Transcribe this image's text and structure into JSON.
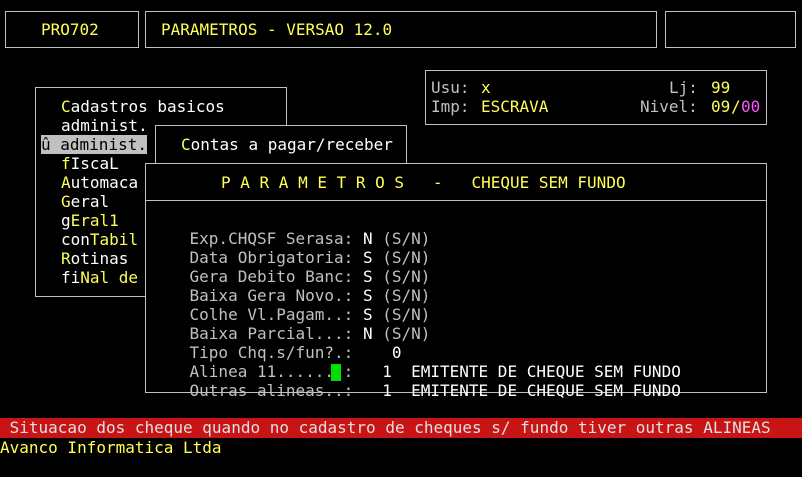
{
  "header": {
    "program_code": "PRO702",
    "title": "PARAMETROS - VERSAO 12.0"
  },
  "user_panel": {
    "usu_label": "Usu:",
    "usu_value": "x",
    "lj_label": "Lj:",
    "lj_value": "99",
    "imp_label": "Imp:",
    "imp_value": "ESCRAVA",
    "nivel_label": "Nivel:",
    "nivel_value_a": "09",
    "nivel_sep": "/",
    "nivel_value_b": "00"
  },
  "main_menu": {
    "items": [
      {
        "hot": "C",
        "rest": "adastros basicos"
      },
      {
        "hot": "",
        "rest": "administ."
      },
      {
        "hot": "û",
        "rest": " administ."
      },
      {
        "hot": "f",
        "rest": "IscaL"
      },
      {
        "hot": "A",
        "rest": "utomaca"
      },
      {
        "hot": "G",
        "rest": "eral"
      },
      {
        "hot": "g",
        "rest": "Eral1"
      },
      {
        "hot": "con",
        "rest": "Tabil"
      },
      {
        "hot": "R",
        "rest": "otinas"
      },
      {
        "hot": "fi",
        "rest": "Nal de"
      }
    ]
  },
  "submenu": {
    "hot": "C",
    "rest": "ontas a pagar/receber"
  },
  "dialog": {
    "title": "P A R A M E T R O S   -   CHEQUE SEM FUNDO",
    "fields": [
      {
        "label": "Exp.CHQSF Serasa:",
        "value": "N",
        "hint": "(S/N)"
      },
      {
        "label": "Data Obrigatoria:",
        "value": "S",
        "hint": "(S/N)"
      },
      {
        "label": "Gera Debito Banc:",
        "value": "S",
        "hint": "(S/N)"
      },
      {
        "label": "Baixa Gera Novo.:",
        "value": "S",
        "hint": "(S/N)"
      },
      {
        "label": "Colhe Vl.Pagam..:",
        "value": "S",
        "hint": "(S/N)"
      },
      {
        "label": "Baixa Parcial...:",
        "value": "N",
        "hint": "(S/N)"
      },
      {
        "label": "Tipo Chq.s/fun?.:",
        "value": "0",
        "hint": ""
      },
      {
        "label": "Alinea 11.......:",
        "value": "1",
        "hint": "EMITENTE DE CHEQUE SEM FUNDO"
      },
      {
        "label": "Outras alineas..:",
        "value": "1",
        "hint": "EMITENTE DE CHEQUE SEM FUNDO"
      }
    ]
  },
  "status_bar": " Situacao dos cheque quando no cadastro de cheques s/ fundo tiver outras ALINEAS",
  "footer": "Avanco Informatica Ltda",
  "colors": {
    "status_bg": "#c81414",
    "highlight": "#ffff55",
    "cursor": "#00e000"
  }
}
